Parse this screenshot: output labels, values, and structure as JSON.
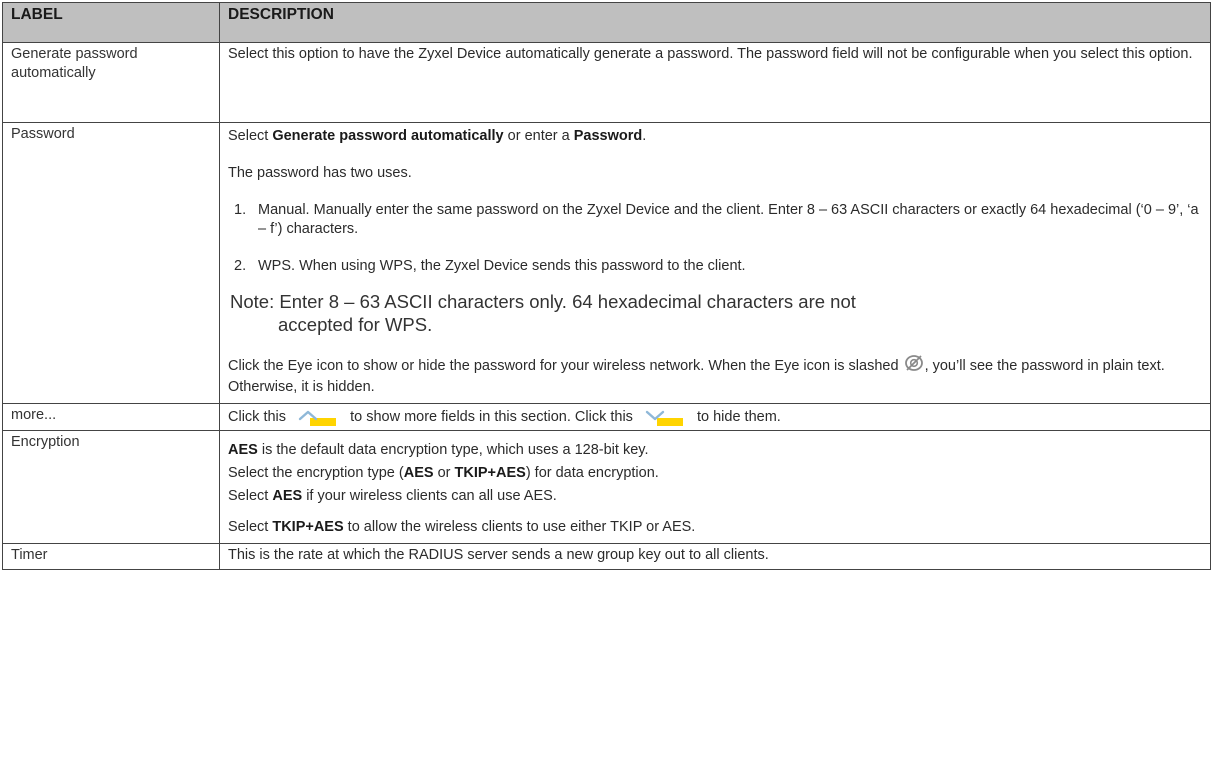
{
  "table": {
    "header": {
      "label": "LABEL",
      "description": "DESCRIPTION"
    },
    "rows": {
      "generate": {
        "label": "Generate password automatically",
        "desc": "Select this option to have the Zyxel Device automatically generate a password. The password field will not be configurable when you select this option."
      },
      "password": {
        "label": "Password",
        "line1_pre": "Select ",
        "line1_bold1": "Generate password automatically",
        "line1_mid": " or enter a ",
        "line1_bold2": "Password",
        "line1_post": ".",
        "line2": "The password has two uses.",
        "step1_num": "1.",
        "step1": "Manual. Manually enter the same password on the Zyxel Device and the client. Enter 8 – 63 ASCII characters or exactly 64 hexadecimal (‘0 – 9’, ‘a – f’) characters.",
        "step2_num": "2.",
        "step2": "WPS. When using WPS, the Zyxel Device sends this password to the client.",
        "note_prefix": "Note: ",
        "note_line1": "Enter 8 – 63 ASCII characters only. 64 hexadecimal characters are not",
        "note_line2": "accepted for WPS.",
        "eye_pre": "Click the Eye icon to show or hide the password for your wireless network. When the Eye icon is slashed ",
        "eye_post": ", you’ll see the password in plain text. Otherwise, it is hidden.",
        "eye_icon": "eye-slashed-icon"
      },
      "more": {
        "label": "more...",
        "pre": "Click this ",
        "mid": " to show more fields in this section. Click this ",
        "post": " to hide them.",
        "expand_icon": "expand-up-arrow-icon",
        "collapse_icon": "collapse-down-arrow-icon"
      },
      "encryption": {
        "label": "Encryption",
        "l1_bold": "AES",
        "l1_rest": " is the default data encryption type, which uses a 128-bit key.",
        "l2_pre": "Select the encryption type (",
        "l2_b1": "AES",
        "l2_mid": " or ",
        "l2_b2": "TKIP+AES",
        "l2_post": ") for data encryption.",
        "l3_pre": "Select ",
        "l3_b": "AES",
        "l3_post": " if your wireless clients can all use AES.",
        "l4_pre": "Select ",
        "l4_b": "TKIP+AES",
        "l4_post": " to allow the wireless clients to use either TKIP or AES."
      },
      "timer": {
        "label": "Timer",
        "desc": "This is the rate at which the RADIUS server sends a new group key out to all clients."
      }
    }
  },
  "colors": {
    "header_bg": "#bfbfbf",
    "border": "#444444",
    "arrow_bg": "#ffd400",
    "arrow_stroke": "#8fb8d8"
  }
}
